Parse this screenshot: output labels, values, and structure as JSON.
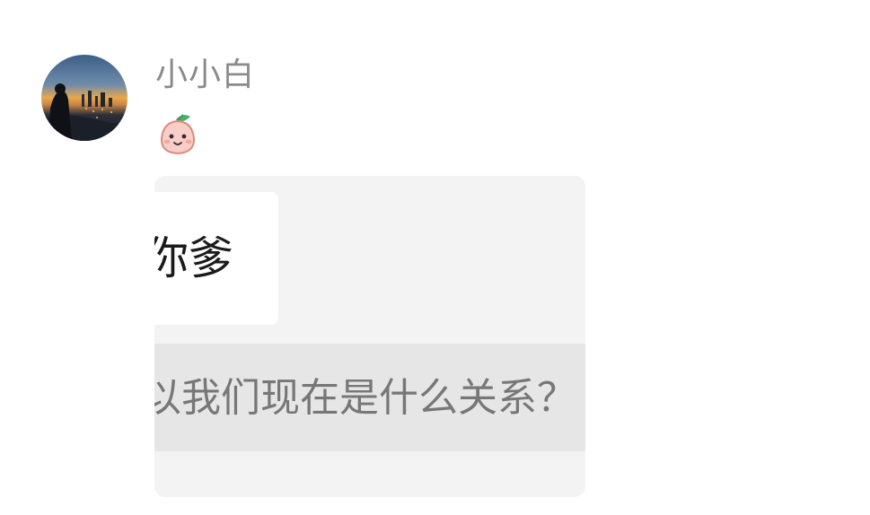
{
  "message": {
    "sender_name": "小小白",
    "avatar_icon": "profile-photo-city-sunset",
    "sticker_icon": "smiling-peach-emoji",
    "quote": {
      "bubble_text": "你爹",
      "bar_text": "以我们现在是什么关系？"
    }
  },
  "colors": {
    "background": "#ffffff",
    "name_text": "#8a8a8a",
    "card_bg": "#f3f3f3",
    "bar_bg": "#e6e6e6",
    "bar_text": "#777777"
  }
}
